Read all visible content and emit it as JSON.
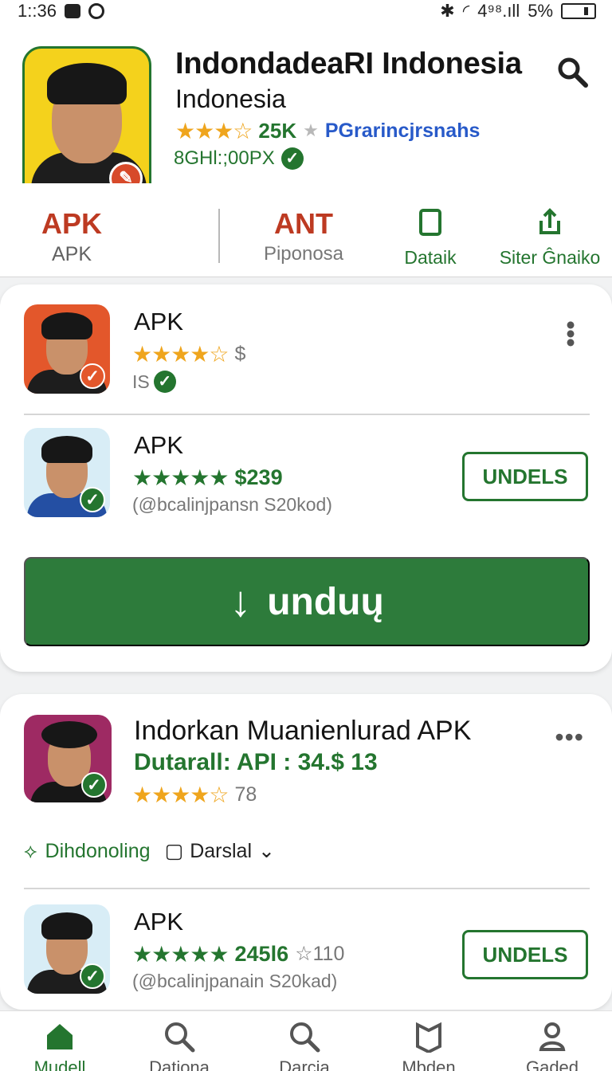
{
  "status_bar": {
    "time": "1::36",
    "signal_text": "4⁹⁸.ıll",
    "battery": "5%"
  },
  "app": {
    "title": "IndondadeaRI Indonesia",
    "subtitle": "Indonesia",
    "rating_stars": "★★★☆",
    "rating_count": "25K",
    "publisher": "PGrarincjrsnahs",
    "version": "8GHl:;00PX"
  },
  "actions": {
    "apk_primary": "APK",
    "apk_secondary": "APK",
    "ant_primary": "ANT",
    "ant_secondary": "Piponosa",
    "details": "Dataik",
    "share": "Siter Ĝnaiko"
  },
  "download_items": [
    {
      "title": "APK",
      "stars": "★★★★☆",
      "price": "$",
      "meta": "IS"
    },
    {
      "title": "APK",
      "stars": "★★★★★",
      "price": "$239",
      "meta": "(@bcalinjpansn S20kod)",
      "button": "UNDELS"
    }
  ],
  "download_button": {
    "label": "unduų"
  },
  "related": {
    "title": "Indorkan Muanienlurad APK",
    "price": "Dutarall: API : 34.$  13",
    "stars": "★★★★☆",
    "count": "78",
    "tag_primary": "Dihdonoling",
    "tag_secondary": "Darslal"
  },
  "related_item": {
    "title": "APK",
    "stars": "★★★★★",
    "price": "245l6",
    "gray_count": "☆110",
    "meta": "(@bcalinjpanain S20kad)",
    "button": "UNDELS"
  },
  "bottom_nav": [
    {
      "label": "Mudell"
    },
    {
      "label": "Dationa"
    },
    {
      "label": "Darcia"
    },
    {
      "label": "Mbden"
    },
    {
      "label": "Gaded"
    }
  ],
  "colors": {
    "accent_green": "#24752f",
    "accent_orange": "#bd3a22",
    "link_blue": "#285ac9",
    "gold": "#efa51d"
  }
}
